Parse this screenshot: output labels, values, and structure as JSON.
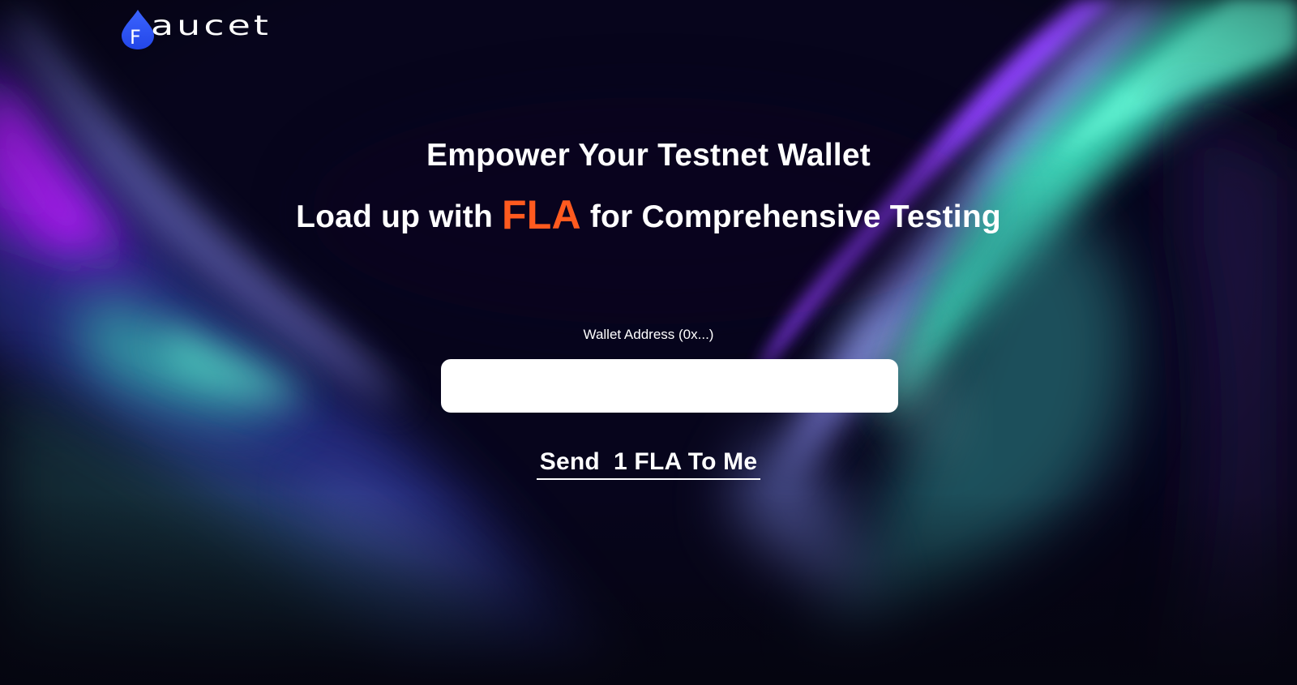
{
  "brand": {
    "logo_letter": "F",
    "logo_word": "aucet"
  },
  "hero": {
    "line1": "Empower Your Testnet Wallet",
    "line2_before": "Load up with ",
    "line2_accent": "FLA",
    "line2_after": " for Comprehensive Testing"
  },
  "form": {
    "label": "Wallet Address (0x...)",
    "input_value": "",
    "input_placeholder": "",
    "submit_label": "Send  1 FLA To Me"
  },
  "colors": {
    "accent": "#ff5a1f",
    "background": "#07051c",
    "logo_blue": "#2f5bff",
    "aurora_purple": "#8a1fe6",
    "aurora_teal": "#3de0c0"
  },
  "icons": {
    "logo": "water-drop-icon"
  }
}
